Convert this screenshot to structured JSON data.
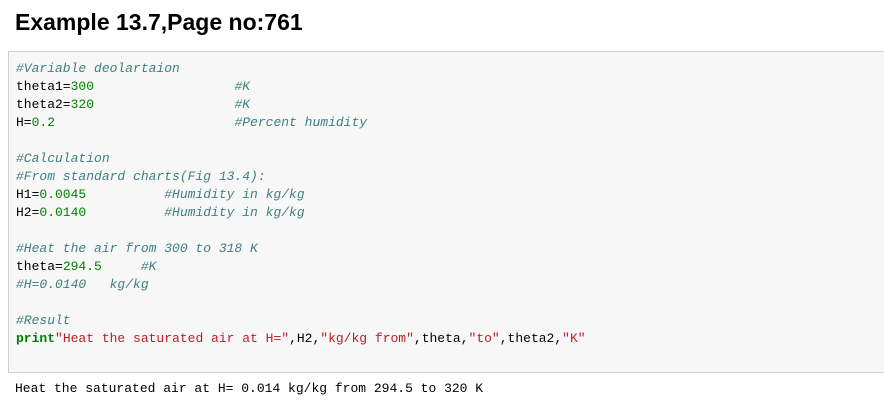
{
  "heading": "Example 13.7,Page no:761",
  "code_lines": [
    [
      {
        "t": "#Variable deolartaion",
        "c": "c"
      }
    ],
    [
      {
        "t": "theta1=",
        "c": "p"
      },
      {
        "t": "300",
        "c": "n"
      },
      {
        "t": "                  ",
        "c": "p"
      },
      {
        "t": "#K",
        "c": "c"
      }
    ],
    [
      {
        "t": "theta2=",
        "c": "p"
      },
      {
        "t": "320",
        "c": "n"
      },
      {
        "t": "                  ",
        "c": "p"
      },
      {
        "t": "#K",
        "c": "c"
      }
    ],
    [
      {
        "t": "H=",
        "c": "p"
      },
      {
        "t": "0.2",
        "c": "n"
      },
      {
        "t": "                       ",
        "c": "p"
      },
      {
        "t": "#Percent humidity",
        "c": "c"
      }
    ],
    [],
    [
      {
        "t": "#Calculation",
        "c": "c"
      }
    ],
    [
      {
        "t": "#From standard charts(Fig 13.4):",
        "c": "c"
      }
    ],
    [
      {
        "t": "H1=",
        "c": "p"
      },
      {
        "t": "0.0045",
        "c": "n"
      },
      {
        "t": "          ",
        "c": "p"
      },
      {
        "t": "#Humidity in kg/kg",
        "c": "c"
      }
    ],
    [
      {
        "t": "H2=",
        "c": "p"
      },
      {
        "t": "0.0140",
        "c": "n"
      },
      {
        "t": "          ",
        "c": "p"
      },
      {
        "t": "#Humidity in kg/kg",
        "c": "c"
      }
    ],
    [],
    [
      {
        "t": "#Heat the air from 300 to 318 K",
        "c": "c"
      }
    ],
    [
      {
        "t": "theta=",
        "c": "p"
      },
      {
        "t": "294.5",
        "c": "n"
      },
      {
        "t": "     ",
        "c": "p"
      },
      {
        "t": "#K",
        "c": "c"
      }
    ],
    [
      {
        "t": "#H=0.0140   kg/kg",
        "c": "c"
      }
    ],
    [],
    [
      {
        "t": "#Result",
        "c": "c"
      }
    ],
    [
      {
        "t": "print",
        "c": "k"
      },
      {
        "t": "\"Heat the saturated air at H=\"",
        "c": "s"
      },
      {
        "t": ",H2,",
        "c": "p"
      },
      {
        "t": "\"kg/kg from\"",
        "c": "s"
      },
      {
        "t": ",theta,",
        "c": "p"
      },
      {
        "t": "\"to\"",
        "c": "s"
      },
      {
        "t": ",theta2,",
        "c": "p"
      },
      {
        "t": "\"K\"",
        "c": "s"
      }
    ]
  ],
  "output": "Heat the saturated air at H= 0.014 kg/kg from 294.5 to 320 K"
}
